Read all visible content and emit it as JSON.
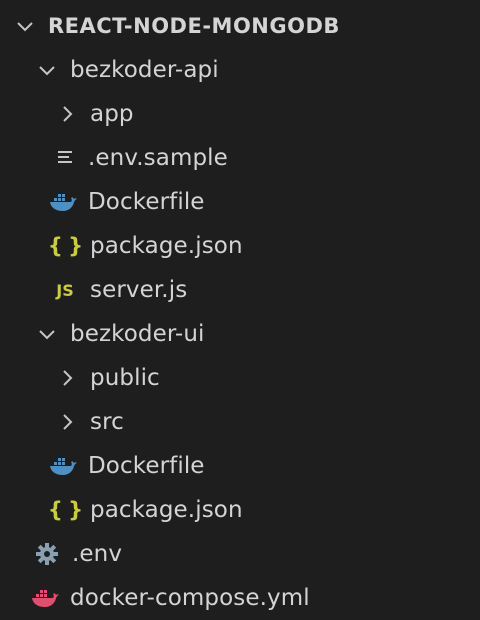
{
  "explorer": {
    "root": {
      "label": "REACT-NODE-MONGODB"
    },
    "items": [
      {
        "label": "bezkoder-api",
        "icon": "chevron-down-icon"
      },
      {
        "label": "app",
        "icon": "chevron-right-icon"
      },
      {
        "label": ".env.sample",
        "icon": "lines-file-icon"
      },
      {
        "label": "Dockerfile",
        "icon": "docker-icon"
      },
      {
        "label": "package.json",
        "icon": "json-braces-icon",
        "icon_text": "{ }"
      },
      {
        "label": "server.js",
        "icon": "javascript-icon",
        "icon_text": "JS"
      },
      {
        "label": "bezkoder-ui",
        "icon": "chevron-down-icon"
      },
      {
        "label": "public",
        "icon": "chevron-right-icon"
      },
      {
        "label": "src",
        "icon": "chevron-right-icon"
      },
      {
        "label": "Dockerfile",
        "icon": "docker-icon"
      },
      {
        "label": "package.json",
        "icon": "json-braces-icon",
        "icon_text": "{ }"
      },
      {
        "label": ".env",
        "icon": "gear-icon"
      },
      {
        "label": "docker-compose.yml",
        "icon": "docker-compose-icon"
      }
    ]
  },
  "colors": {
    "background": "#1e1e1e",
    "text": "#d4d4d4",
    "chevron": "#c5c5c5",
    "docker_blue": "#4d90c4",
    "json_yellow": "#cbcb41",
    "compose_pink": "#e04f6e",
    "gear_gray": "#8aa0b0"
  }
}
